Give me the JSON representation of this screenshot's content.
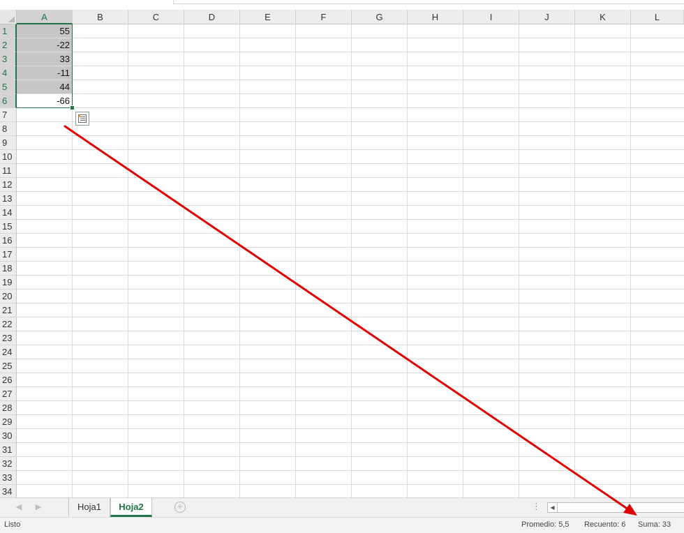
{
  "columns": [
    "A",
    "B",
    "C",
    "D",
    "E",
    "F",
    "G",
    "H",
    "I",
    "J",
    "K",
    "L"
  ],
  "rows": [
    "1",
    "2",
    "3",
    "4",
    "5",
    "6",
    "7",
    "8",
    "9",
    "10",
    "11",
    "12",
    "13",
    "14",
    "15",
    "16",
    "17",
    "18",
    "19",
    "20",
    "21",
    "22",
    "23",
    "24",
    "25",
    "26",
    "27",
    "28",
    "29",
    "30",
    "31",
    "32",
    "33",
    "34"
  ],
  "cells": [
    "55",
    "-22",
    "33",
    "-11",
    "44",
    "-66"
  ],
  "sheets": [
    "Hoja1",
    "Hoja2"
  ],
  "active_sheet": "Hoja2",
  "status": {
    "ready": "Listo",
    "average": "Promedio: 5,5",
    "count": "Recuento: 6",
    "sum": "Suma: 33"
  },
  "colors": {
    "accent": "#217346",
    "annotation_arrow": "#e00000"
  },
  "icons": {
    "quick_analysis": "quick-analysis-icon",
    "add_sheet": "plus-circle-icon",
    "nav_prev": "triangle-left-icon",
    "nav_next": "triangle-right-icon",
    "scroll_left": "triangle-left-icon"
  }
}
